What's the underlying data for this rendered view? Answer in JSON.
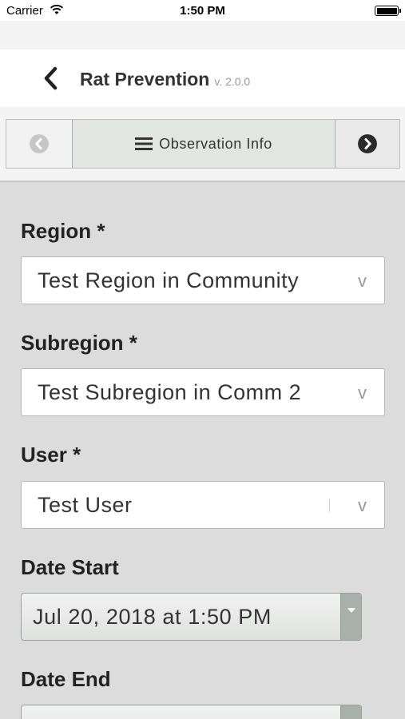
{
  "status_bar": {
    "carrier": "Carrier",
    "time": "1:50 PM"
  },
  "header": {
    "title": "Rat Prevention",
    "version": "v. 2.0.0"
  },
  "toolbar": {
    "section_label": "Observation Info"
  },
  "form": {
    "region": {
      "label": "Region *",
      "value": "Test Region in Community",
      "chevron": "v"
    },
    "subregion": {
      "label": "Subregion *",
      "value": "Test Subregion in Comm 2",
      "chevron": "v"
    },
    "user": {
      "label": "User *",
      "value": "Test User",
      "chevron": "v"
    },
    "date_start": {
      "label": "Date Start",
      "value": "Jul 20, 2018 at 1:50 PM"
    },
    "date_end": {
      "label": "Date End",
      "value": ""
    }
  },
  "colors": {
    "accent": "#333333",
    "background": "#dcdcdc"
  }
}
